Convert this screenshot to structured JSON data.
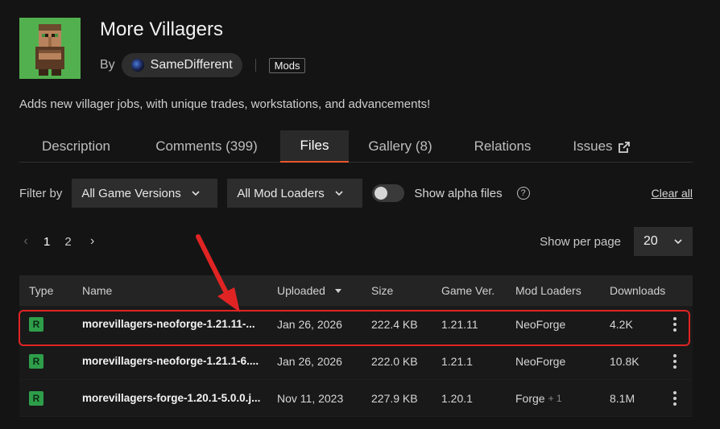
{
  "mod": {
    "title": "More Villagers",
    "by_label": "By",
    "author": "SameDifferent",
    "tag": "Mods",
    "description": "Adds new villager jobs, with unique trades, workstations, and advancements!"
  },
  "tabs": [
    {
      "label": "Description",
      "active": false
    },
    {
      "label": "Comments (399)",
      "active": false
    },
    {
      "label": "Files",
      "active": true
    },
    {
      "label": "Gallery (8)",
      "active": false
    },
    {
      "label": "Relations",
      "active": false
    },
    {
      "label": "Issues",
      "active": false,
      "external": true
    }
  ],
  "filters": {
    "label": "Filter by",
    "game_versions": "All Game Versions",
    "mod_loaders": "All Mod Loaders",
    "alpha_label": "Show alpha files",
    "alpha_enabled": false,
    "clear_all": "Clear all"
  },
  "pagination": {
    "pages": [
      "1",
      "2"
    ],
    "current": "1",
    "per_page_label": "Show per page",
    "per_page": "20"
  },
  "table": {
    "headers": {
      "type": "Type",
      "name": "Name",
      "uploaded": "Uploaded",
      "size": "Size",
      "game_ver": "Game Ver.",
      "mod_loaders": "Mod Loaders",
      "downloads": "Downloads"
    },
    "rows": [
      {
        "type": "R",
        "name": "morevillagers-neoforge-1.21.11-...",
        "uploaded": "Jan 26, 2026",
        "size": "222.4 KB",
        "game_ver": "1.21.11",
        "mod_loaders": "NeoForge",
        "extra_loaders": "",
        "downloads": "4.2K"
      },
      {
        "type": "R",
        "name": "morevillagers-neoforge-1.21.1-6....",
        "uploaded": "Jan 26, 2026",
        "size": "222.0 KB",
        "game_ver": "1.21.1",
        "mod_loaders": "NeoForge",
        "extra_loaders": "",
        "downloads": "10.8K"
      },
      {
        "type": "R",
        "name": "morevillagers-forge-1.20.1-5.0.0.j...",
        "uploaded": "Nov 11, 2023",
        "size": "227.9 KB",
        "game_ver": "1.20.1",
        "mod_loaders": "Forge",
        "extra_loaders": "+ 1",
        "downloads": "8.1M"
      }
    ]
  },
  "colors": {
    "accent": "#e8562a",
    "release_badge": "#2e9e4a",
    "annotation": "#e02424"
  }
}
